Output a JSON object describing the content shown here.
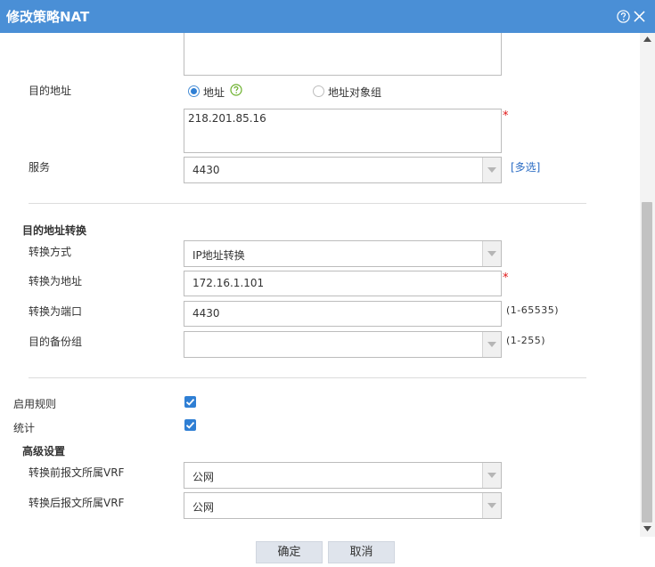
{
  "window": {
    "title": "修改策略NAT",
    "help_icon": "help-circle-icon",
    "close_icon": "close-icon"
  },
  "destination": {
    "label": "目的地址",
    "radio_address": "地址",
    "radio_group": "地址对象组",
    "selected": "地址",
    "address_value": "218.201.85.16"
  },
  "service": {
    "label": "服务",
    "value": "4430",
    "multi_link": "[多选]"
  },
  "dnat": {
    "section_title": "目的地址转换",
    "method_label": "转换方式",
    "method_value": "IP地址转换",
    "to_address_label": "转换为地址",
    "to_address_value": "172.16.1.101",
    "to_port_label": "转换为端口",
    "to_port_value": "4430",
    "to_port_hint": "(1-65535)",
    "backup_label": "目的备份组",
    "backup_value": "",
    "backup_hint": "(1-255)"
  },
  "options": {
    "enable_label": "启用规则",
    "enable_checked": true,
    "stats_label": "统计",
    "stats_checked": true
  },
  "advanced": {
    "section_title": "高级设置",
    "vrf_before_label": "转换前报文所属VRF",
    "vrf_before_value": "公网",
    "vrf_after_label": "转换后报文所属VRF",
    "vrf_after_value": "公网"
  },
  "footer": {
    "ok_label": "确定",
    "cancel_label": "取消"
  },
  "colors": {
    "titlebar": "#4a8fd6",
    "accent": "#2f7fd4",
    "required": "#e01515",
    "link": "#2b6cc4"
  }
}
